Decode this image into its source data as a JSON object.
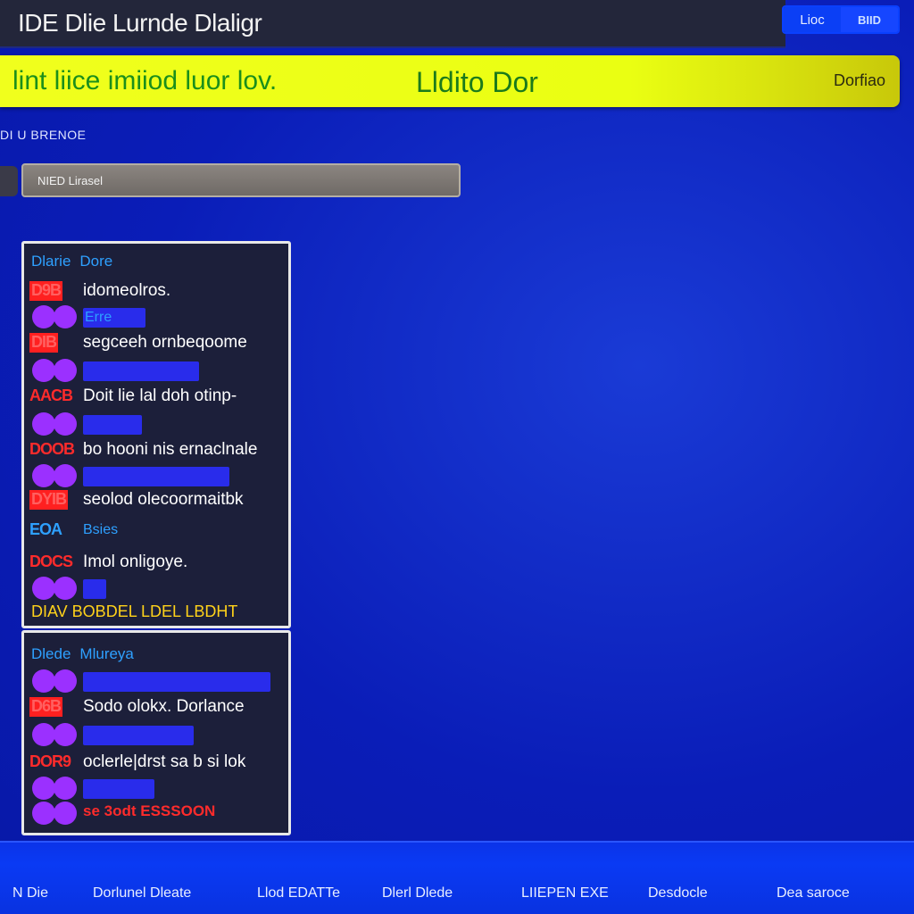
{
  "titlebar": {
    "title": "IDE Dlie Lurnde Dlaligr"
  },
  "top_buttons": [
    "Lioc",
    "BIID"
  ],
  "banner": {
    "left_text": "lint liice imiiod luor lov.",
    "mid_text": "Lldito Dor",
    "right_text": "Dorfiao"
  },
  "section_label": "DI U BRENOE",
  "search": {
    "placeholder": "NIED Lirasel"
  },
  "panel1": {
    "header_a": "Dlarie",
    "header_b": "Dore",
    "entries": [
      {
        "tag": "D9B",
        "text": "idomeolros."
      },
      {
        "sub_label": "Erre"
      },
      {
        "tag": "DIB",
        "text": "segceeh ornbeqoome"
      },
      {
        "tag": "AACB",
        "text": "Doit lie lal doh otinp-"
      },
      {
        "tag": "DOOB",
        "text": "bo hooni nis ernaclnale"
      },
      {
        "tag": "DYIB",
        "text": "seolod olecoormaitbk"
      },
      {
        "tag": "EOA",
        "sub_label": "Bsies"
      },
      {
        "tag": "DOCS",
        "text": "Imol onligoye."
      }
    ],
    "footer": "DIAV BOBDEL LDEL LBDHT"
  },
  "panel2": {
    "header_a": "Dlede",
    "header_b": "Mlureya",
    "entries": [
      {
        "tag": "D6B",
        "text": "Sodo olokx. Dorlance"
      },
      {
        "tag": "DOR9",
        "text": "oclerle|drst sa b si lok"
      }
    ],
    "red_row": "se 3odt ESSSOON"
  },
  "statusbar": [
    "N Die",
    "Dorlunel Dleate",
    "Llod EDATTe",
    "Dlerl Dlede",
    "LIIEPEN EXE",
    "Desdocle",
    "Dea saroce"
  ],
  "colors": {
    "background": "#0a1db8",
    "banner": "#eaff12",
    "accent_blue": "#2ea0ff",
    "tag_red": "#ff2b2b",
    "heart_purple": "#9b30ff",
    "footer_yellow": "#ffd21a"
  }
}
